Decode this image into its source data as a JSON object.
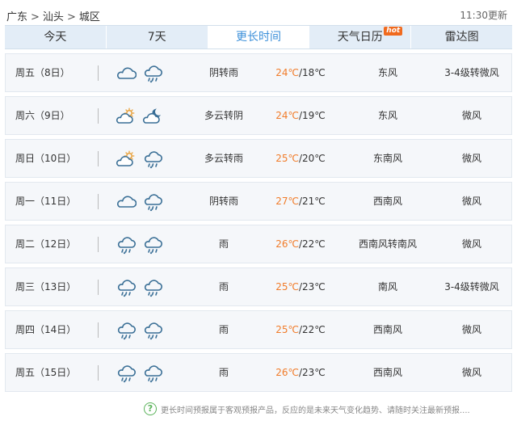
{
  "breadcrumb": {
    "province": "广东",
    "city": "汕头",
    "district": "城区"
  },
  "update_time": "11:30更新",
  "tabs": [
    {
      "label": "今天",
      "active": false,
      "badge": ""
    },
    {
      "label": "7天",
      "active": false,
      "badge": ""
    },
    {
      "label": "更长时间",
      "active": true,
      "badge": ""
    },
    {
      "label": "天气日历",
      "active": false,
      "badge": "hot"
    },
    {
      "label": "雷达图",
      "active": false,
      "badge": ""
    }
  ],
  "days": [
    {
      "day": "周五（8日）",
      "icons": [
        "cloud-icon",
        "rain-icon"
      ],
      "condition": "阴转雨",
      "high": "24℃",
      "sep": "/",
      "low": "18℃",
      "wind_dir": "东风",
      "wind_level": "3-4级转微风"
    },
    {
      "day": "周六（9日）",
      "icons": [
        "partly-cloudy-day-icon",
        "partly-cloudy-night-icon"
      ],
      "condition": "多云转阴",
      "high": "24℃",
      "sep": "/",
      "low": "19℃",
      "wind_dir": "东风",
      "wind_level": "微风"
    },
    {
      "day": "周日（10日）",
      "icons": [
        "partly-cloudy-day-icon",
        "rain-icon"
      ],
      "condition": "多云转雨",
      "high": "25℃",
      "sep": "/",
      "low": "20℃",
      "wind_dir": "东南风",
      "wind_level": "微风"
    },
    {
      "day": "周一（11日）",
      "icons": [
        "cloud-icon",
        "rain-icon"
      ],
      "condition": "阴转雨",
      "high": "27℃",
      "sep": "/",
      "low": "21℃",
      "wind_dir": "西南风",
      "wind_level": "微风"
    },
    {
      "day": "周二（12日）",
      "icons": [
        "rain-icon",
        "rain-icon"
      ],
      "condition": "雨",
      "high": "26℃",
      "sep": "/",
      "low": "22℃",
      "wind_dir": "西南风转南风",
      "wind_level": "微风"
    },
    {
      "day": "周三（13日）",
      "icons": [
        "rain-icon",
        "rain-icon"
      ],
      "condition": "雨",
      "high": "25℃",
      "sep": "/",
      "low": "23℃",
      "wind_dir": "南风",
      "wind_level": "3-4级转微风"
    },
    {
      "day": "周四（14日）",
      "icons": [
        "rain-icon",
        "rain-icon"
      ],
      "condition": "雨",
      "high": "25℃",
      "sep": "/",
      "low": "22℃",
      "wind_dir": "西南风",
      "wind_level": "微风"
    },
    {
      "day": "周五（15日）",
      "icons": [
        "rain-icon",
        "rain-icon"
      ],
      "condition": "雨",
      "high": "26℃",
      "sep": "/",
      "low": "23℃",
      "wind_dir": "西南风",
      "wind_level": "微风"
    }
  ],
  "footer": {
    "icon": "help-icon",
    "glyph": "?",
    "text": "更长时间预报属于客观预报产品，反应的是未来天气变化趋势、请随时关注最新预报...."
  },
  "colors": {
    "accent": "#3b8fd9",
    "high_temp": "#f17c2a",
    "hot_badge": "#f06a1e",
    "tab_bar": "#e3edf7",
    "row_bg": "#f5f7fa",
    "icon_stroke": "#3a6f96"
  }
}
